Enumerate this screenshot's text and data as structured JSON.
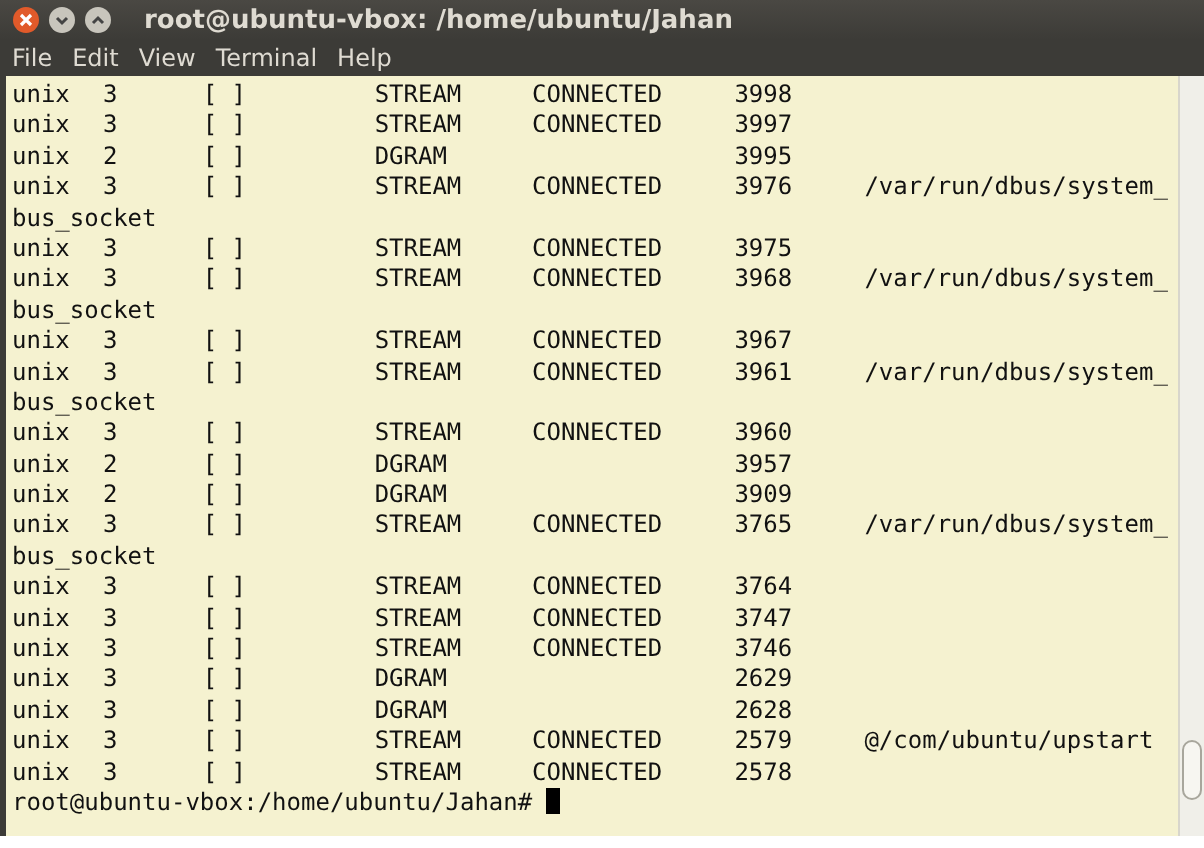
{
  "window": {
    "title": "root@ubuntu-vbox: /home/ubuntu/Jahan"
  },
  "menu": [
    "File",
    "Edit",
    "View",
    "Terminal",
    "Help"
  ],
  "terminal": {
    "rows": [
      {
        "proto": "unix",
        "refcnt": "3",
        "flags": "[ ]",
        "type": "STREAM",
        "state": "CONNECTED",
        "inode": "3998"
      },
      {
        "proto": "unix",
        "refcnt": "3",
        "flags": "[ ]",
        "type": "STREAM",
        "state": "CONNECTED",
        "inode": "3997"
      },
      {
        "proto": "unix",
        "refcnt": "2",
        "flags": "[ ]",
        "type": "DGRAM",
        "inode": "3995"
      },
      {
        "proto": "unix",
        "refcnt": "3",
        "flags": "[ ]",
        "type": "STREAM",
        "state": "CONNECTED",
        "inode": "3976",
        "path": "/var/run/dbus/system_",
        "path_wrap": "bus_socket"
      },
      {
        "proto": "unix",
        "refcnt": "3",
        "flags": "[ ]",
        "type": "STREAM",
        "state": "CONNECTED",
        "inode": "3975"
      },
      {
        "proto": "unix",
        "refcnt": "3",
        "flags": "[ ]",
        "type": "STREAM",
        "state": "CONNECTED",
        "inode": "3968",
        "path": "/var/run/dbus/system_",
        "path_wrap": "bus_socket"
      },
      {
        "proto": "unix",
        "refcnt": "3",
        "flags": "[ ]",
        "type": "STREAM",
        "state": "CONNECTED",
        "inode": "3967"
      },
      {
        "proto": "unix",
        "refcnt": "3",
        "flags": "[ ]",
        "type": "STREAM",
        "state": "CONNECTED",
        "inode": "3961",
        "path": "/var/run/dbus/system_",
        "path_wrap": "bus_socket"
      },
      {
        "proto": "unix",
        "refcnt": "3",
        "flags": "[ ]",
        "type": "STREAM",
        "state": "CONNECTED",
        "inode": "3960"
      },
      {
        "proto": "unix",
        "refcnt": "2",
        "flags": "[ ]",
        "type": "DGRAM",
        "inode": "3957"
      },
      {
        "proto": "unix",
        "refcnt": "2",
        "flags": "[ ]",
        "type": "DGRAM",
        "inode": "3909"
      },
      {
        "proto": "unix",
        "refcnt": "3",
        "flags": "[ ]",
        "type": "STREAM",
        "state": "CONNECTED",
        "inode": "3765",
        "path": "/var/run/dbus/system_",
        "path_wrap": "bus_socket"
      },
      {
        "proto": "unix",
        "refcnt": "3",
        "flags": "[ ]",
        "type": "STREAM",
        "state": "CONNECTED",
        "inode": "3764"
      },
      {
        "proto": "unix",
        "refcnt": "3",
        "flags": "[ ]",
        "type": "STREAM",
        "state": "CONNECTED",
        "inode": "3747"
      },
      {
        "proto": "unix",
        "refcnt": "3",
        "flags": "[ ]",
        "type": "STREAM",
        "state": "CONNECTED",
        "inode": "3746"
      },
      {
        "proto": "unix",
        "refcnt": "3",
        "flags": "[ ]",
        "type": "DGRAM",
        "inode": "2629"
      },
      {
        "proto": "unix",
        "refcnt": "3",
        "flags": "[ ]",
        "type": "DGRAM",
        "inode": "2628"
      },
      {
        "proto": "unix",
        "refcnt": "3",
        "flags": "[ ]",
        "type": "STREAM",
        "state": "CONNECTED",
        "inode": "2579",
        "path": "@/com/ubuntu/upstart"
      },
      {
        "proto": "unix",
        "refcnt": "3",
        "flags": "[ ]",
        "type": "STREAM",
        "state": "CONNECTED",
        "inode": "2578"
      }
    ],
    "prompt": "root@ubuntu-vbox:/home/ubuntu/Jahan#"
  }
}
